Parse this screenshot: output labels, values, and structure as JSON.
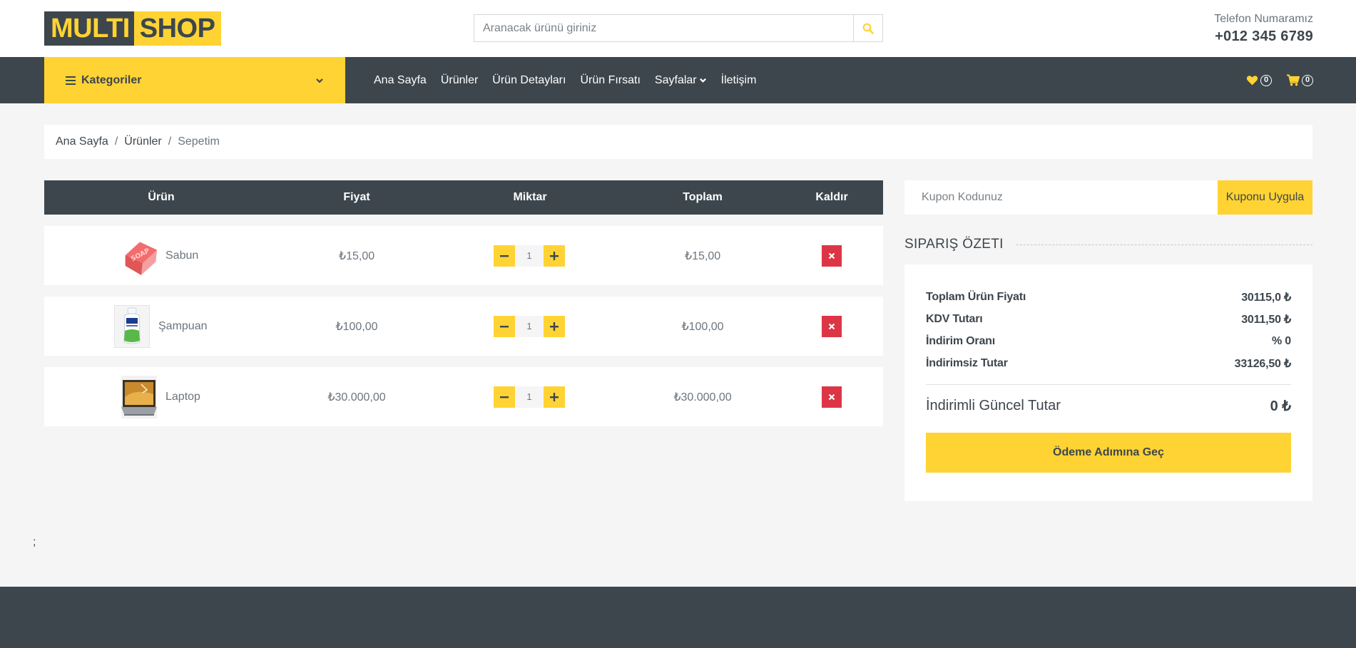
{
  "header": {
    "logo_part1": "MULTI",
    "logo_part2": "SHOP",
    "search_placeholder": "Aranacak ürünü giriniz",
    "phone_label": "Telefon Numaramız",
    "phone_number": "+012 345 6789"
  },
  "nav": {
    "categories_label": "Kategoriler",
    "links": [
      "Ana Sayfa",
      "Ürünler",
      "Ürün Detayları",
      "Ürün Fırsatı",
      "Sayfalar",
      "İletişim"
    ],
    "wishlist_count": "0",
    "cart_count": "0"
  },
  "breadcrumb": {
    "items": [
      "Ana Sayfa",
      "Ürünler"
    ],
    "current": "Sepetim",
    "separator": "/"
  },
  "cart": {
    "columns": [
      "Ürün",
      "Fiyat",
      "Miktar",
      "Toplam",
      "Kaldır"
    ],
    "rows": [
      {
        "name": "Sabun",
        "price": "₺15,00",
        "qty": "1",
        "total": "₺15,00",
        "image": "soap-image"
      },
      {
        "name": "Şampuan",
        "price": "₺100,00",
        "qty": "1",
        "total": "₺100,00",
        "image": "shampoo-image"
      },
      {
        "name": "Laptop",
        "price": "₺30.000,00",
        "qty": "1",
        "total": "₺30.000,00",
        "image": "laptop-image"
      }
    ]
  },
  "coupon": {
    "placeholder": "Kupon Kodunuz",
    "button": "Kuponu Uygula"
  },
  "summary": {
    "title": "SIPARIŞ ÖZETI",
    "lines": [
      {
        "label": "Toplam Ürün Fiyatı",
        "value": "30115,0 ₺"
      },
      {
        "label": "KDV Tutarı",
        "value": "3011,50 ₺"
      },
      {
        "label": "İndirim Oranı",
        "value": "% 0"
      },
      {
        "label": "İndirimsiz Tutar",
        "value": "33126,50 ₺"
      }
    ],
    "total_label": "İndirimli Güncel Tutar",
    "total_value": "0 ₺",
    "checkout": "Ödeme Adımına Geç"
  },
  "stray_text": ";",
  "colors": {
    "accent": "#ffd333",
    "dark": "#3d464d",
    "danger": "#dc3545",
    "background": "#f5f5f5"
  }
}
